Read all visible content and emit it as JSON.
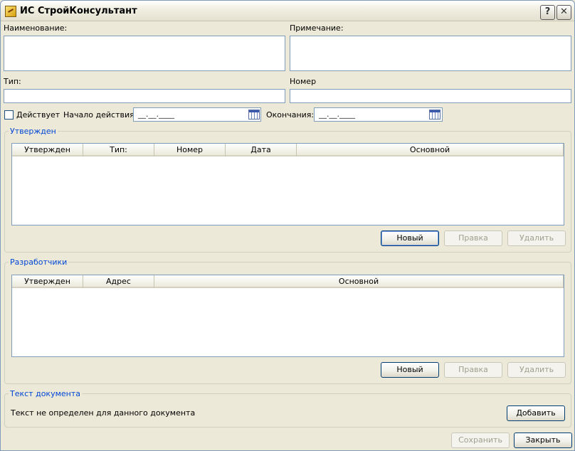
{
  "window": {
    "title": "ИС СтройКонсультант",
    "help_label": "?",
    "close_label": "✕"
  },
  "fields": {
    "name_label": "Наименование:",
    "note_label": "Примечание:",
    "type_label": "Тип:",
    "number_label": "Номер",
    "active_label": "Действует",
    "active_checked": false,
    "start_label": "Начало действия:",
    "start_value": "__.__.____",
    "end_label": "Окончания:",
    "end_value": "__.__.____"
  },
  "approved": {
    "title": "Утвержден",
    "columns": [
      "Утвержден",
      "Тип:",
      "Номер",
      "Дата",
      "Основной"
    ],
    "rows": [],
    "new_label": "Новый",
    "edit_label": "Правка",
    "delete_label": "Удалить"
  },
  "developers": {
    "title": "Разработчики",
    "columns": [
      "Утвержден",
      "Адрес",
      "Основной"
    ],
    "rows": [],
    "new_label": "Новый",
    "edit_label": "Правка",
    "delete_label": "Удалить"
  },
  "doc_text": {
    "title": "Текст документа",
    "message": "Текст не определен для данного документа",
    "add_label": "Добавить"
  },
  "footer": {
    "save_label": "Сохранить",
    "close_label": "Закрыть"
  },
  "colors": {
    "group_title": "#0046d5",
    "border": "#7f9db9",
    "background": "#ece9d8"
  }
}
